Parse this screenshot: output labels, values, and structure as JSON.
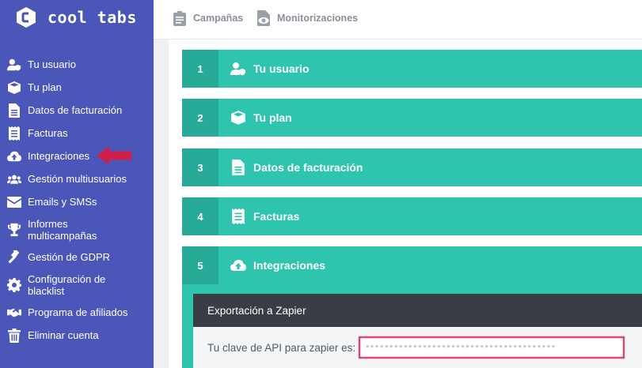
{
  "brand": {
    "name": "cool tabs"
  },
  "sidebar": {
    "items": [
      {
        "label": "Tu usuario",
        "icon": "user-shield-icon"
      },
      {
        "label": "Tu plan",
        "icon": "cube-icon"
      },
      {
        "label": "Datos de facturación",
        "icon": "file-invoice-icon"
      },
      {
        "label": "Facturas",
        "icon": "receipt-icon"
      },
      {
        "label": "Integraciones",
        "icon": "cloud-upload-icon"
      },
      {
        "label": "Gestión multiusuarios",
        "icon": "users-icon"
      },
      {
        "label": "Emails y SMSs",
        "icon": "envelope-icon"
      },
      {
        "label": "Informes multicampañas",
        "icon": "trophy-icon"
      },
      {
        "label": "Gestión de GDPR",
        "icon": "gavel-icon"
      },
      {
        "label": "Configuración de blacklist",
        "icon": "cog-icon"
      },
      {
        "label": "Programa de afiliados",
        "icon": "handshake-icon"
      },
      {
        "label": "Eliminar cuenta",
        "icon": "trash-icon"
      }
    ]
  },
  "topbar": {
    "tabs": [
      {
        "label": "Campañas",
        "icon": "clipboard-icon"
      },
      {
        "label": "Monitorizaciones",
        "icon": "monitor-eye-icon"
      }
    ]
  },
  "accordion": {
    "items": [
      {
        "number": "1",
        "title": "Tu usuario",
        "icon": "user-shield-icon"
      },
      {
        "number": "2",
        "title": "Tu plan",
        "icon": "cube-icon"
      },
      {
        "number": "3",
        "title": "Datos de facturación",
        "icon": "file-invoice-icon"
      },
      {
        "number": "4",
        "title": "Facturas",
        "icon": "receipt-icon"
      },
      {
        "number": "5",
        "title": "Integraciones",
        "icon": "cloud-upload-icon"
      }
    ]
  },
  "zapier": {
    "title": "Exportación a Zapier",
    "key_label": "Tu clave de API para zapier es:",
    "key_value": "••••••••••••••••••••••••••••••••••••••••"
  },
  "colors": {
    "sidebar": "#4a57b9",
    "accordion": "#2ec4ad",
    "accordion_number": "#27ab98",
    "panel_header": "#3b3d44",
    "highlight": "#d01e4b"
  }
}
